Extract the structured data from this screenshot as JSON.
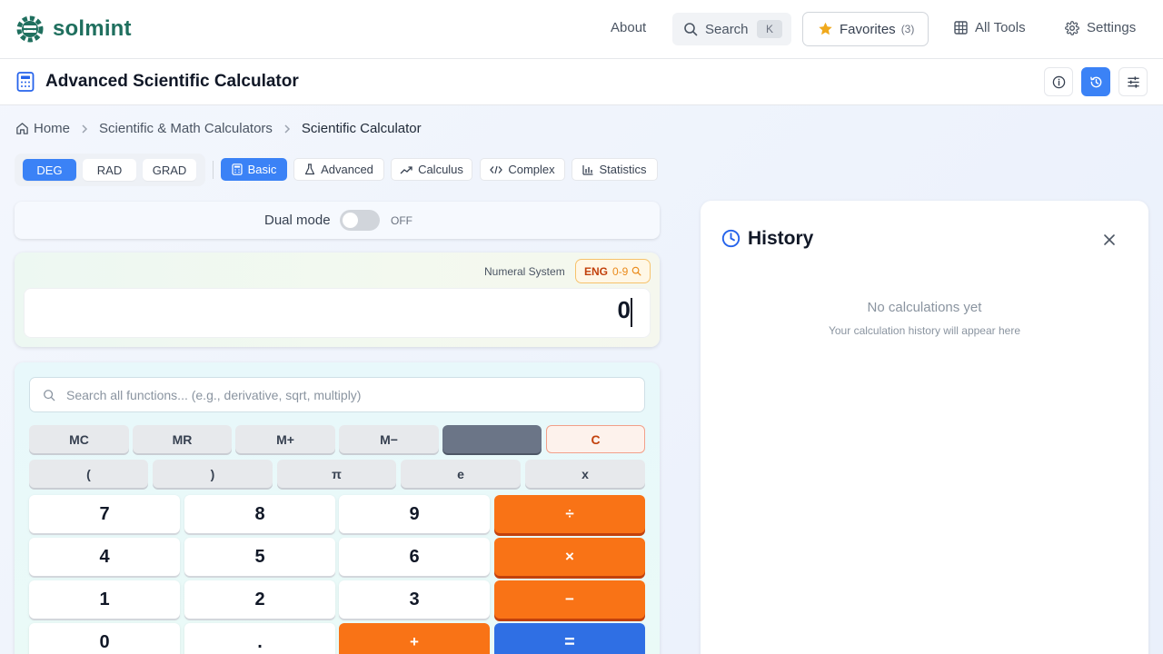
{
  "nav": {
    "brand": "solmint",
    "about": "About",
    "search_label": "Search",
    "search_shortcut": "K",
    "favorites_label": "Favorites",
    "favorites_count": "(3)",
    "all_tools": "All Tools",
    "settings": "Settings"
  },
  "page": {
    "title": "Advanced Scientific Calculator",
    "toolbar_icons": [
      "info-icon",
      "history-icon",
      "sliders-icon"
    ],
    "active_toolbar_icon": "history-icon"
  },
  "breadcrumb": {
    "home": "Home",
    "category": "Scientific & Math Calculators",
    "current": "Scientific Calculator"
  },
  "angle_modes": {
    "items": [
      "DEG",
      "RAD",
      "GRAD"
    ],
    "selected": "DEG"
  },
  "calc_modes": {
    "items": [
      "Basic",
      "Advanced",
      "Calculus",
      "Complex",
      "Statistics"
    ],
    "selected": "Basic"
  },
  "dual_mode": {
    "label": "Dual mode",
    "state": "OFF"
  },
  "display": {
    "numeral_system_label": "Numeral System",
    "numeral_badge": "ENG",
    "numeral_range": "0-9",
    "value": "0"
  },
  "keypad": {
    "search_placeholder": "Search all functions... (e.g., derivative, sqrt, multiply)",
    "memory_row": [
      "MC",
      "MR",
      "M+",
      "M−",
      "",
      "C"
    ],
    "const_row": [
      "(",
      ")",
      "π",
      "e",
      "x"
    ],
    "rows": [
      [
        "7",
        "8",
        "9",
        "÷"
      ],
      [
        "4",
        "5",
        "6",
        "×"
      ],
      [
        "1",
        "2",
        "3",
        "−"
      ],
      [
        "0",
        ".",
        "+",
        "="
      ]
    ]
  },
  "history": {
    "title": "History",
    "empty_title": "No calculations yet",
    "empty_subtitle": "Your calculation history will appear here"
  },
  "colors": {
    "brand": "#1f6f5e",
    "accent": "#3b82f6",
    "operator": "#f97316",
    "equals": "#2f6fe4"
  }
}
